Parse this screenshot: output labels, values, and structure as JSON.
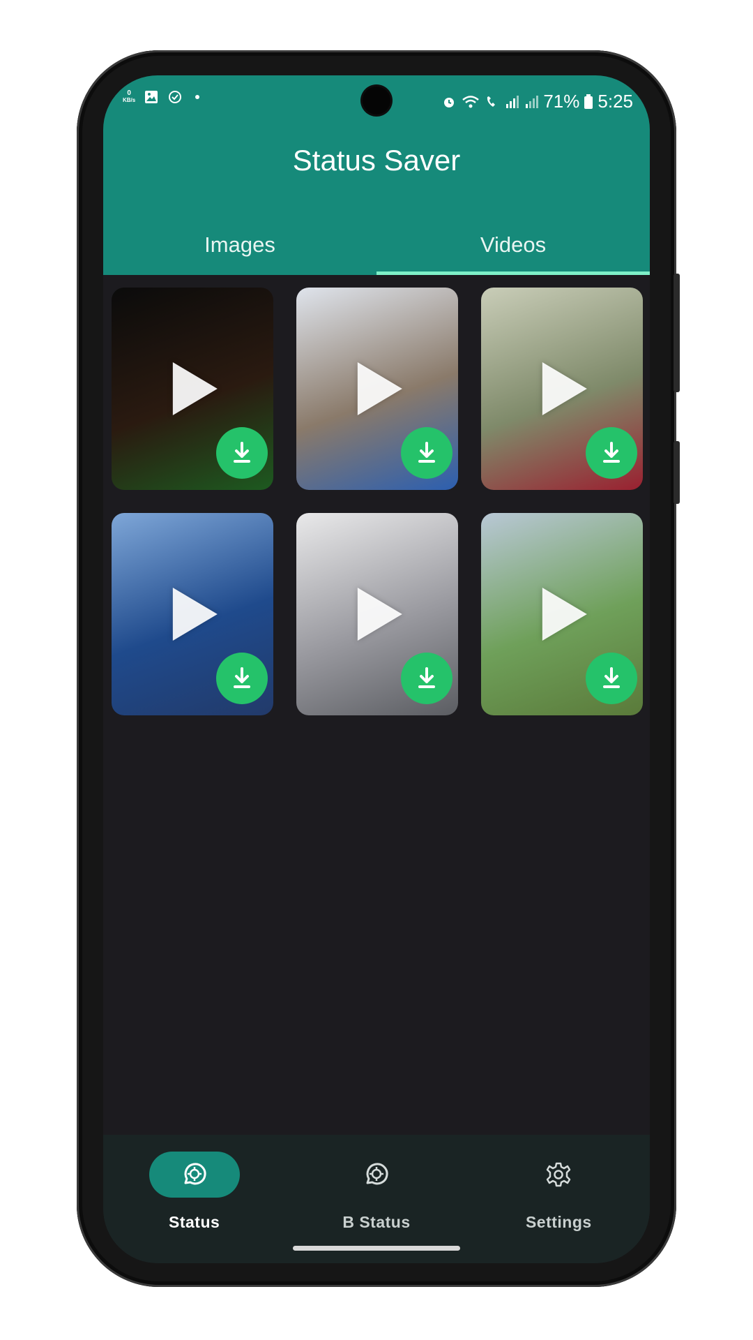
{
  "status_bar": {
    "speed_value": "0",
    "speed_unit": "KB/s",
    "battery": "71%",
    "time": "5:25"
  },
  "app": {
    "title": "Status Saver"
  },
  "tabs": [
    {
      "label": "Images",
      "active": false
    },
    {
      "label": "Videos",
      "active": true
    }
  ],
  "videos": [
    {
      "name": "video-1",
      "thumb_colors": [
        "#0b0b0b",
        "#2a1a10",
        "#1d5a20"
      ]
    },
    {
      "name": "video-2",
      "thumb_colors": [
        "#dfe4ec",
        "#8a7a6a",
        "#2c5fb0"
      ]
    },
    {
      "name": "video-3",
      "thumb_colors": [
        "#c9cdb8",
        "#7f8a6a",
        "#9a2030"
      ]
    },
    {
      "name": "video-4",
      "thumb_colors": [
        "#7fa7d8",
        "#1f4a8c",
        "#223a6a"
      ]
    },
    {
      "name": "video-5",
      "thumb_colors": [
        "#e9e9ea",
        "#9a9aa0",
        "#5b5d62"
      ]
    },
    {
      "name": "video-6",
      "thumb_colors": [
        "#b9c8d6",
        "#6fa05a",
        "#5a7a3a"
      ]
    }
  ],
  "bottom_nav": [
    {
      "label": "Status",
      "icon": "status-icon",
      "active": true
    },
    {
      "label": "B Status",
      "icon": "business-status-icon",
      "active": false
    },
    {
      "label": "Settings",
      "icon": "gear-icon",
      "active": false
    }
  ],
  "colors": {
    "primary": "#168a7a",
    "download": "#25c26a",
    "background": "#1c1b1f",
    "tab_indicator": "#7ef0c8"
  }
}
